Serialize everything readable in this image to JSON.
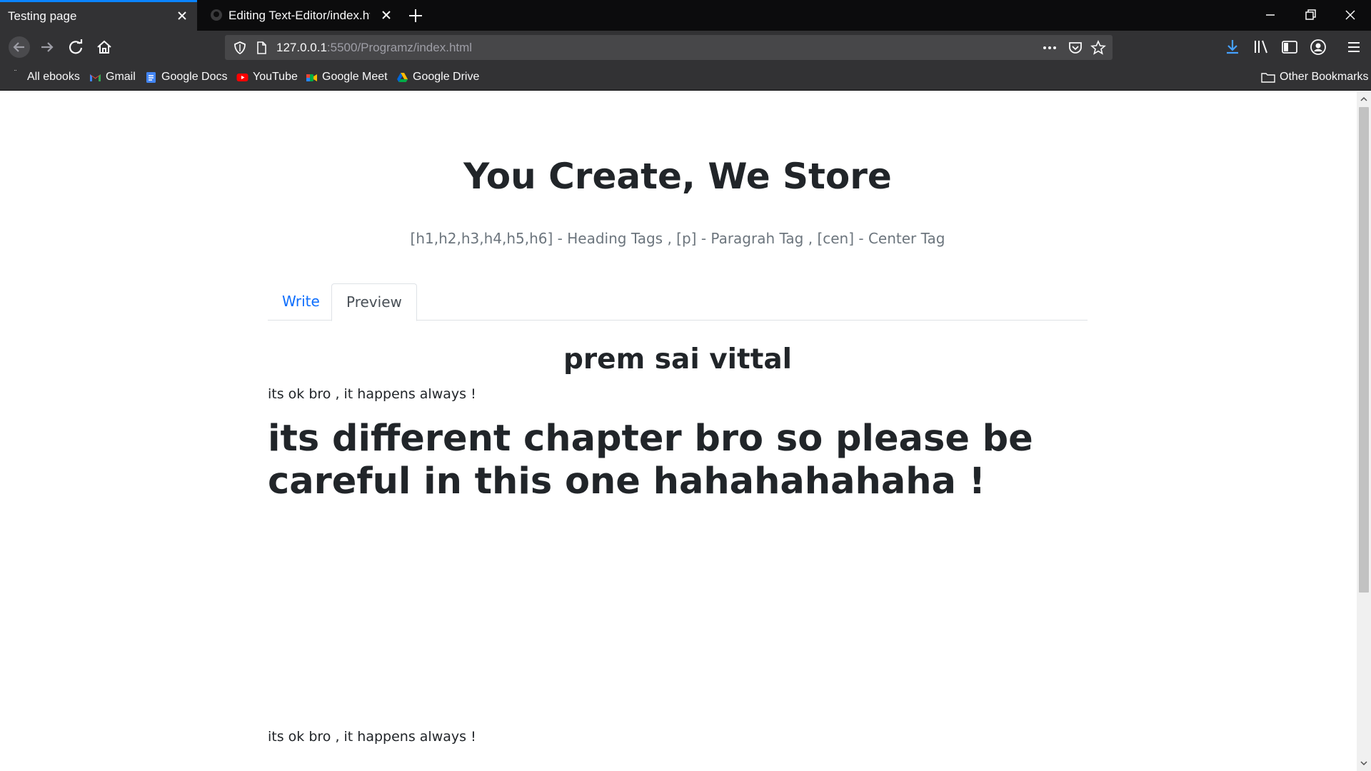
{
  "browser": {
    "tabs": [
      {
        "title": "Testing page",
        "active": true
      },
      {
        "title": "Editing Text-Editor/index.html at",
        "active": false
      }
    ],
    "url": {
      "host": "127.0.0.1",
      "rest": ":5500/Programz/index.html"
    },
    "bookmarks": [
      {
        "label": "All ebooks",
        "icon": "ebook-icon"
      },
      {
        "label": "Gmail",
        "icon": "gmail-icon"
      },
      {
        "label": "Google Docs",
        "icon": "docs-icon"
      },
      {
        "label": "YouTube",
        "icon": "youtube-icon"
      },
      {
        "label": "Google Meet",
        "icon": "meet-icon"
      },
      {
        "label": "Google Drive",
        "icon": "drive-icon"
      }
    ],
    "other_bookmarks": "Other Bookmarks",
    "accent_color": "#0a84ff"
  },
  "page": {
    "title": "You Create, We Store",
    "hint": "[h1,h2,h3,h4,h5,h6] - Heading Tags , [p] - Paragrah Tag , [cen] - Center Tag",
    "tabs": {
      "write": "Write",
      "preview": "Preview"
    },
    "preview": {
      "heading_centered": "prem sai vittal",
      "paragraph_1": "its ok bro , it happens always !",
      "heading_large": "its different chapter bro so please be careful in this one hahahahahaha !",
      "paragraph_2": "its ok bro , it happens always !"
    }
  }
}
